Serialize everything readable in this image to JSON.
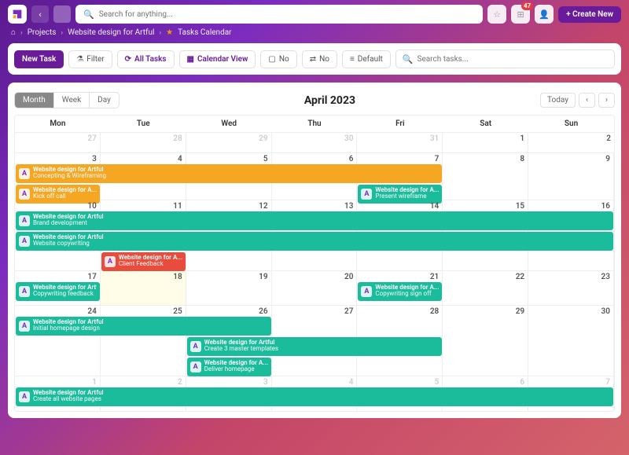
{
  "header": {
    "search_placeholder": "Search for anything...",
    "notification_count": "47",
    "create_button": "+ Create New"
  },
  "breadcrumb": {
    "home": "⌂",
    "items": [
      "Projects",
      "Website design for Artful",
      "Tasks Calendar"
    ]
  },
  "toolbar": {
    "new_task": "New Task",
    "filter": "Filter",
    "all_tasks": "All Tasks",
    "calendar_view": "Calendar View",
    "no1": "No",
    "no2": "No",
    "default": "Default",
    "search_placeholder": "Search tasks..."
  },
  "calendar": {
    "views": {
      "month": "Month",
      "week": "Week",
      "day": "Day"
    },
    "title": "April 2023",
    "today": "Today",
    "days": [
      "Mon",
      "Tue",
      "Wed",
      "Thu",
      "Fri",
      "Sat",
      "Sun"
    ],
    "weeks": [
      {
        "nums": [
          "27",
          "28",
          "29",
          "30",
          "31",
          "1",
          "2"
        ],
        "other": [
          0,
          1,
          2,
          3,
          4
        ]
      },
      {
        "nums": [
          "3",
          "4",
          "5",
          "6",
          "7",
          "8",
          "9"
        ]
      },
      {
        "nums": [
          "10",
          "11",
          "12",
          "13",
          "14",
          "15",
          "16"
        ]
      },
      {
        "nums": [
          "17",
          "18",
          "19",
          "20",
          "21",
          "22",
          "23"
        ],
        "today": 1
      },
      {
        "nums": [
          "24",
          "25",
          "26",
          "27",
          "28",
          "29",
          "30"
        ]
      },
      {
        "nums": [
          "1",
          "2",
          "3",
          "4",
          "5",
          "6",
          "7"
        ],
        "other": [
          0,
          1,
          2,
          3,
          4,
          5,
          6
        ]
      }
    ]
  },
  "events": {
    "w1": [
      {
        "proj": "Website design for Artful",
        "task": "Concepting & Wireframing",
        "color": "orange",
        "start": 0,
        "span": 5,
        "row": 0
      },
      {
        "proj": "Website design for A...",
        "task": "Kick off call",
        "color": "orange",
        "start": 0,
        "span": 1,
        "row": 1
      },
      {
        "proj": "Website design for A...",
        "task": "Present wireframe",
        "color": "green",
        "start": 4,
        "span": 1,
        "row": 1
      }
    ],
    "w2": [
      {
        "proj": "Website design for Artful",
        "task": "Brand development",
        "color": "green",
        "start": 0,
        "span": 7,
        "row": 0
      },
      {
        "proj": "Website design for Artful",
        "task": "Website copywriting",
        "color": "green",
        "start": 0,
        "span": 7,
        "row": 1
      },
      {
        "proj": "Website design for A...",
        "task": "Client Feedback",
        "color": "red",
        "start": 1,
        "span": 1,
        "row": 2
      }
    ],
    "w3": [
      {
        "proj": "Website design for Artful",
        "task": "Copywriting feedback",
        "color": "green",
        "start": 0,
        "span": 1,
        "row": 0
      },
      {
        "proj": "Website design for A...",
        "task": "Copywriting sign off",
        "color": "green",
        "start": 4,
        "span": 1,
        "row": 0
      }
    ],
    "w4": [
      {
        "proj": "Website design for Artful",
        "task": "Initial homepage design",
        "color": "green",
        "start": 0,
        "span": 3,
        "row": 0
      },
      {
        "proj": "Website design for Artful",
        "task": "Create 3 master templates",
        "color": "green",
        "start": 2,
        "span": 3,
        "row": 1
      },
      {
        "proj": "Website design for A...",
        "task": "Deliver homepage",
        "color": "green",
        "start": 2,
        "span": 1,
        "row": 2
      }
    ],
    "w5": [
      {
        "proj": "Website design for Artful",
        "task": "Create all website pages",
        "color": "green",
        "start": 0,
        "span": 7,
        "row": 0
      }
    ]
  }
}
